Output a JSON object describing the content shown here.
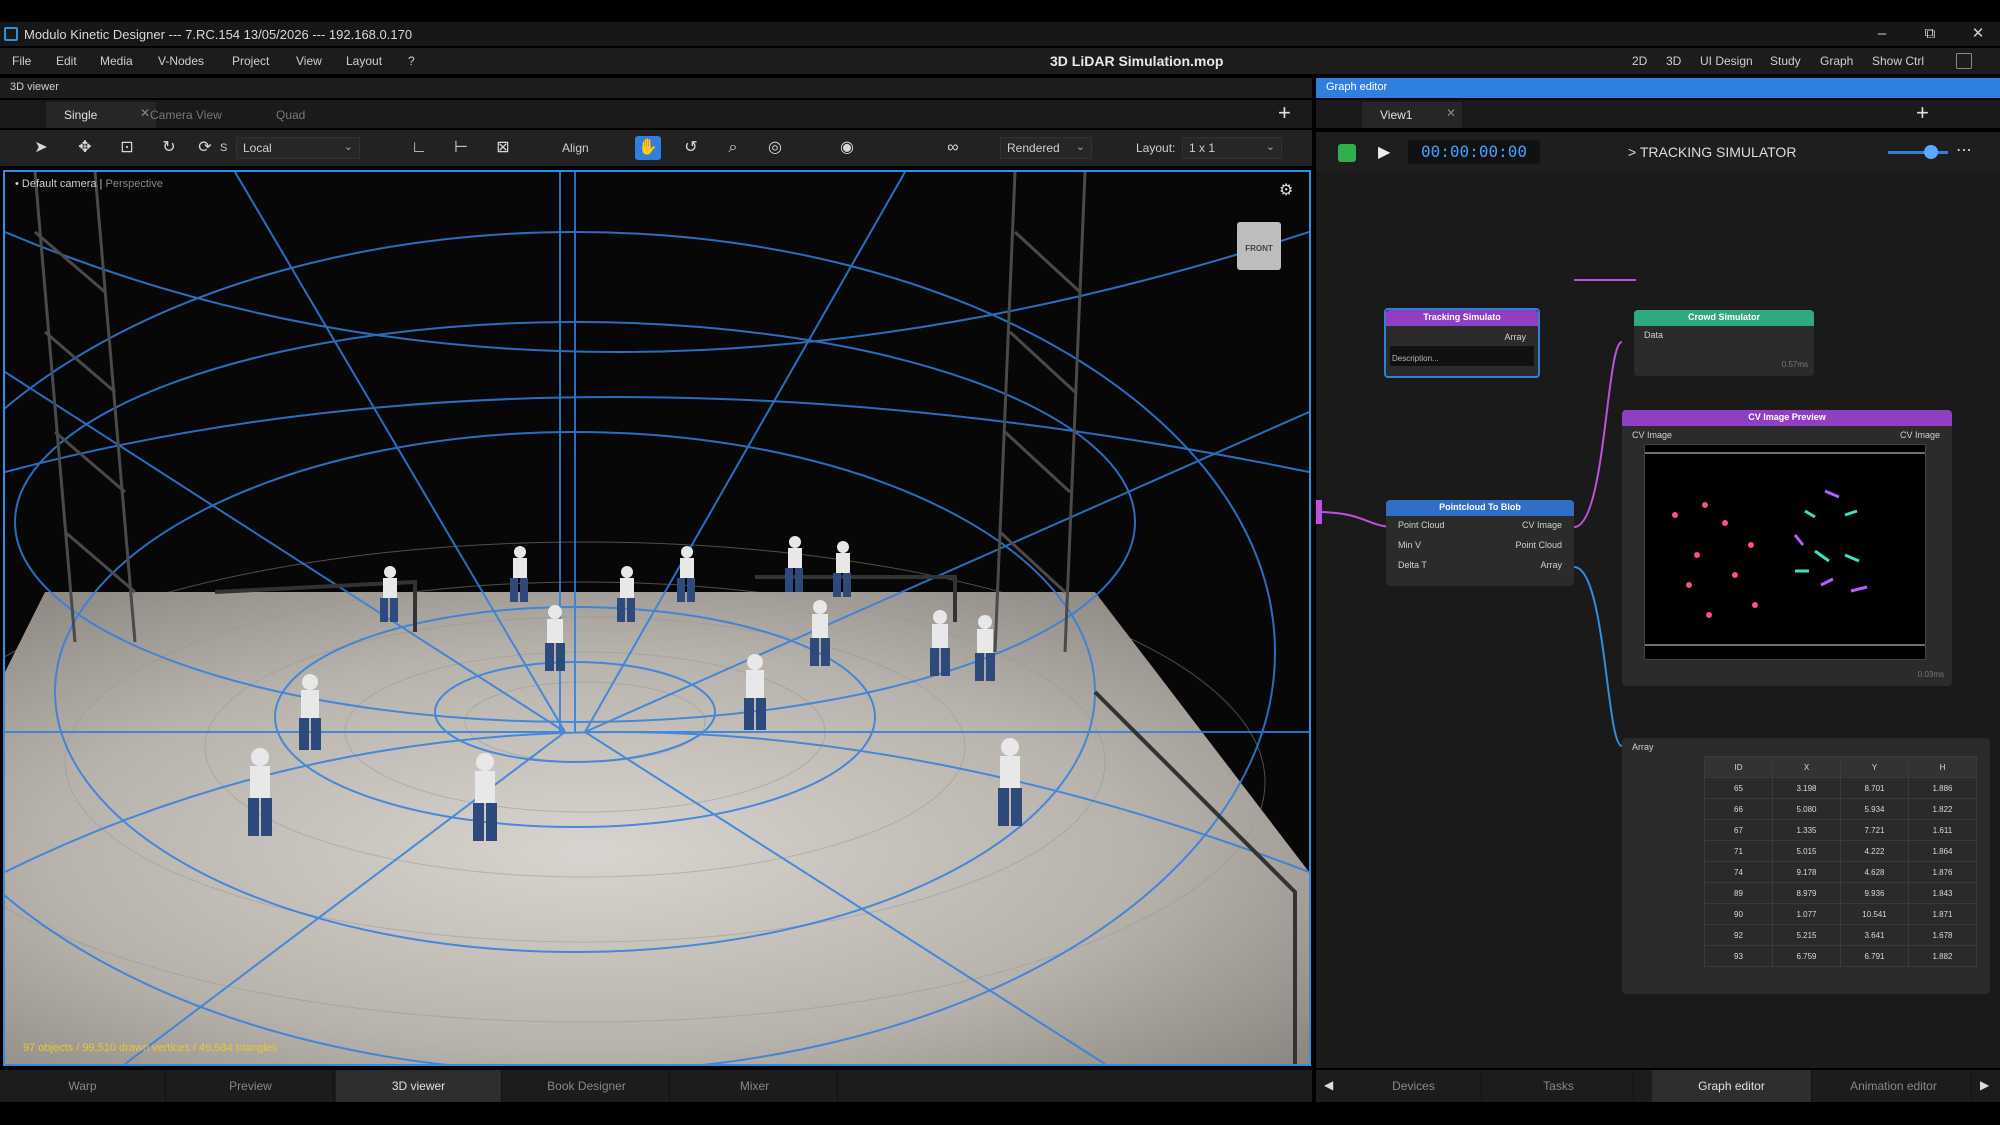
{
  "window": {
    "title": "Modulo Kinetic Designer --- 7.RC.154 13/05/2026 --- 192.168.0.170",
    "controls": [
      "–",
      "⧉",
      "✕"
    ]
  },
  "menubar": {
    "items": [
      "File",
      "Edit",
      "Media",
      "V-Nodes",
      "Project",
      "View",
      "Layout",
      "?"
    ],
    "doc_title": "3D LiDAR Simulation.mop",
    "modes": [
      "2D",
      "3D",
      "UI Design",
      "Study",
      "Graph",
      "Show Ctrl"
    ]
  },
  "left_panel": {
    "header": "3D viewer",
    "tabs": [
      {
        "label": "Single",
        "active": true
      },
      {
        "label": "Camera View",
        "active": false
      },
      {
        "label": "Quad",
        "active": false
      }
    ],
    "toolbar": {
      "space_label": "S",
      "space_value": "Local",
      "align_label": "Align",
      "render_mode": "Rendered",
      "layout_label": "Layout:",
      "layout_value": "1 x 1"
    },
    "viewport": {
      "camera_label": "• Default camera",
      "projection": "Perspective",
      "gizmo_label": "FRONT",
      "stats": "97 objects / 99,510 drawn vertices / 49,584 triangles"
    },
    "bottom_tabs": [
      {
        "label": "Warp",
        "active": false
      },
      {
        "label": "Preview",
        "active": false
      },
      {
        "label": "3D viewer",
        "active": true
      },
      {
        "label": "Book Designer",
        "active": false
      },
      {
        "label": "Mixer",
        "active": false
      }
    ]
  },
  "right_panel": {
    "header": "Graph editor",
    "tab": "View1",
    "timecode": "00:00:00:00",
    "graph_title": "> TRACKING SIMULATOR",
    "nodes": {
      "tracking": {
        "title": "Tracking Simulato",
        "out": "Array",
        "desc": "Description..."
      },
      "crowd": {
        "title": "Crowd Simulator",
        "in": "Data",
        "time": "0.57ms"
      },
      "cv_preview": {
        "title": "CV Image Preview",
        "in": "CV Image",
        "out": "CV Image",
        "time": "0.03ms"
      },
      "pointcloud": {
        "title": "Pointcloud To Blob",
        "inputs": [
          "Point Cloud",
          "Min V",
          "Delta T"
        ],
        "outputs": [
          "CV Image",
          "Point Cloud",
          "Array"
        ]
      },
      "array": {
        "in": "Array"
      }
    },
    "table": {
      "headers": [
        "ID",
        "X",
        "Y",
        "H"
      ],
      "rows": [
        [
          "65",
          "3.198",
          "8.701",
          "1.886"
        ],
        [
          "66",
          "5.080",
          "5.934",
          "1.822"
        ],
        [
          "67",
          "1.335",
          "7.721",
          "1.611"
        ],
        [
          "71",
          "5.015",
          "4.222",
          "1.864"
        ],
        [
          "74",
          "9.178",
          "4.628",
          "1.876"
        ],
        [
          "89",
          "8.979",
          "9.936",
          "1.843"
        ],
        [
          "90",
          "1.077",
          "10.541",
          "1.871"
        ],
        [
          "92",
          "5.215",
          "3.641",
          "1.678"
        ],
        [
          "93",
          "6.759",
          "6.791",
          "1.882"
        ]
      ]
    },
    "bottom_tabs": [
      {
        "label": "Devices",
        "active": false
      },
      {
        "label": "Tasks",
        "active": false
      },
      {
        "label": "Graph editor",
        "active": true
      },
      {
        "label": "Animation editor",
        "active": false
      }
    ]
  },
  "colors": {
    "accent": "#2f8fe0",
    "tracking_node": "#8e3fc2",
    "crowd_node": "#2faa7f",
    "pointcloud_node": "#2f6fc8",
    "cv_node": "#8e3fc2",
    "stats_text": "#e8c830"
  }
}
